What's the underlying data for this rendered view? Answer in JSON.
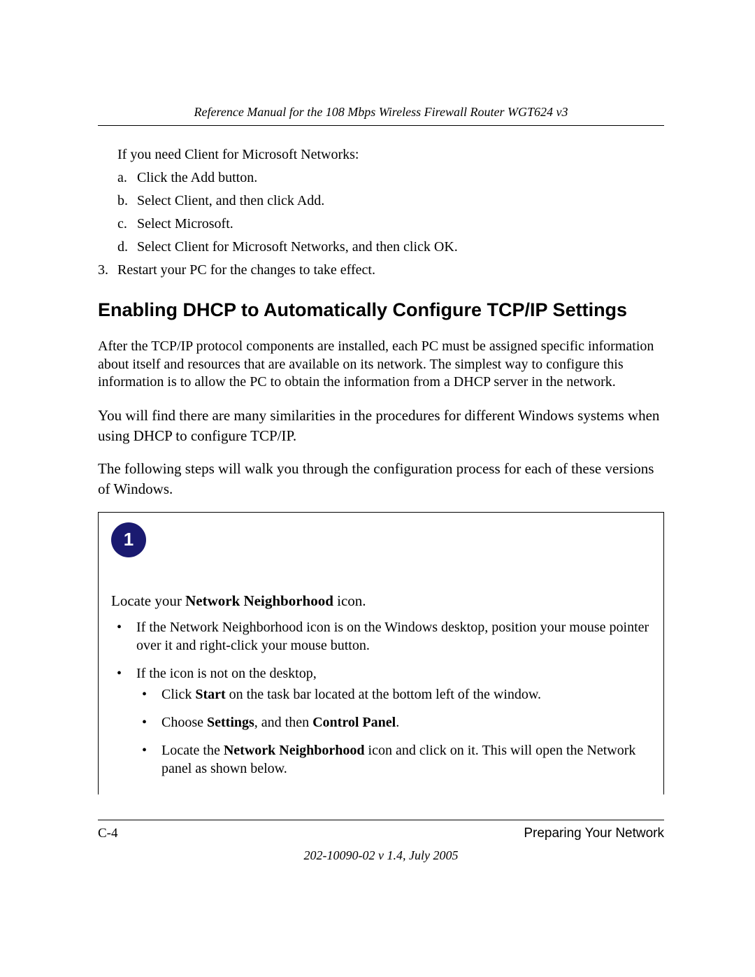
{
  "header": {
    "title": "Reference Manual for the 108 Mbps Wireless Firewall Router WGT624 v3"
  },
  "client_section": {
    "intro": "If you need Client for Microsoft Networks:",
    "steps": {
      "a": "Click the Add button.",
      "b": "Select Client, and then click Add.",
      "c": "Select Microsoft.",
      "d": "Select Client for Microsoft Networks, and then click OK."
    },
    "restart": "Restart your PC for the changes to take effect."
  },
  "section_heading": "Enabling DHCP to Automatically Configure TCP/IP Settings",
  "paragraphs": {
    "p1": "After the TCP/IP protocol components are installed, each PC must be assigned specific information about itself and resources that are available on its network. The simplest way to configure this information is to allow the PC to obtain the information from a DHCP server in the network.",
    "p2": "You will find there are many similarities in the procedures for different Windows systems when using DHCP to configure TCP/IP.",
    "p3": "The following steps will walk you through the configuration process for each of these versions of Windows."
  },
  "step_box": {
    "number": "1",
    "intro_pre": "Locate your ",
    "intro_bold": "Network Neighborhood",
    "intro_post": " icon.",
    "bullets": {
      "b1": "If the Network Neighborhood icon is on the Windows desktop, position your mouse pointer over it and right-click your mouse button.",
      "b2": "If the icon is not on the desktop,",
      "sub": {
        "s1_pre": "Click ",
        "s1_bold": "Start",
        "s1_post": " on the task bar located at the bottom left of the window.",
        "s2_pre": "Choose ",
        "s2_bold1": "Settings",
        "s2_mid": ", and then ",
        "s2_bold2": "Control Panel",
        "s2_post": ".",
        "s3_pre": "Locate the ",
        "s3_bold": "Network Neighborhood",
        "s3_post": " icon and click on it. This will open the Network panel as shown below."
      }
    }
  },
  "footer": {
    "page_number": "C-4",
    "section_name": "Preparing Your Network",
    "doc_version": "202-10090-02 v 1.4, July 2005"
  }
}
